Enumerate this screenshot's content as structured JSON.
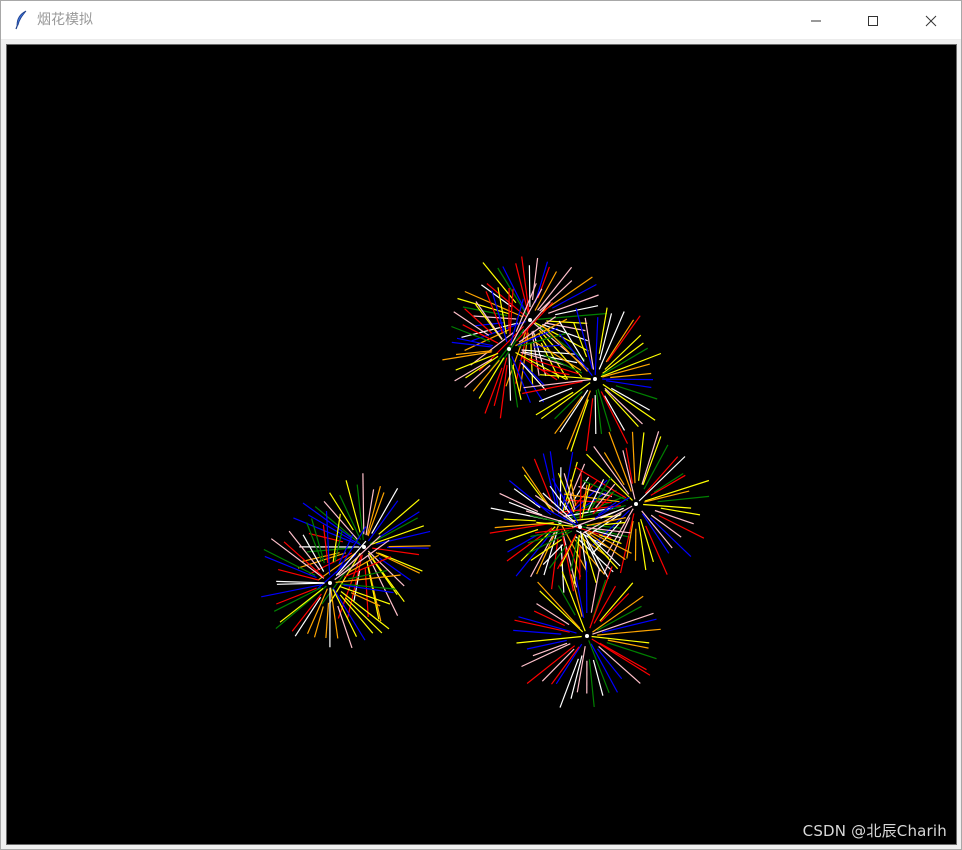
{
  "window": {
    "title": "烟花模拟",
    "icon": "feather-icon",
    "controls": [
      "minimize-icon",
      "maximize-icon",
      "close-icon"
    ]
  },
  "canvas": {
    "background": "#000000",
    "palette": [
      "#ff0000",
      "#ffff00",
      "#0000ff",
      "#008000",
      "#ffa500",
      "#ffffff",
      "#ffc0cb"
    ]
  },
  "watermark": "CSDN @北辰Charih"
}
